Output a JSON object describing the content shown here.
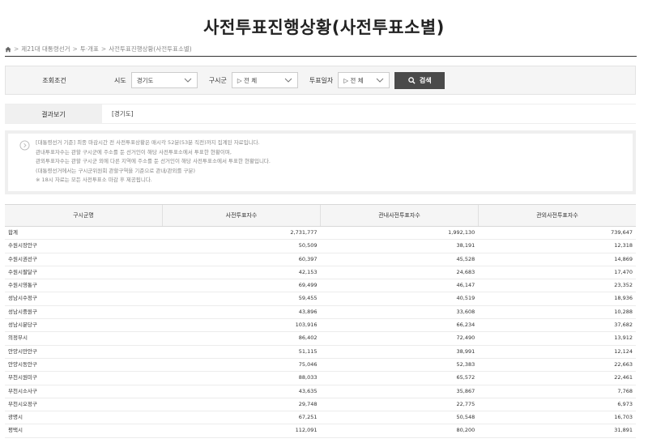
{
  "title": "사전투표진행상황(사전투표소별)",
  "breadcrumb": [
    "제21대 대통령선거",
    "투·개표",
    "사전투표진행상황(사전투표소별)"
  ],
  "search": {
    "label": "조회조건",
    "fields": [
      {
        "label": "시도",
        "value": "경기도"
      },
      {
        "label": "구시군",
        "value": "▷ 전 체"
      },
      {
        "label": "투표일자",
        "value": "▷ 전 체"
      }
    ],
    "button": "검색"
  },
  "result": {
    "label": "결과보기",
    "value": "[경기도]"
  },
  "notice": [
    "[대통령선거 기준] 최종 마감시간 전 사전투표상황은 매시각 52분(53분 직전)까지 집계된 자료입니다.",
    "관내투표자수는 관할 구시군에 주소를 둔 선거인이 해당 사전투표소에서 투표한 현황이며,",
    "관외투표자수는 관할 구시군 외에 다른 지역에 주소를 둔 선거인이 해당 사전투표소에서 투표한 현황입니다.",
    "(대통령선거에서는 구시군위원회 관할구역을 기준으로 관내/관외를 구분)",
    "※ 18시 자료는 모든 사전투표소 마감 후 제공됩니다."
  ],
  "table": {
    "headers": [
      "구시군명",
      "사전투표자수",
      "관내사전투표자수",
      "관외사전투표자수"
    ],
    "rows": [
      [
        "합계",
        "2,731,777",
        "1,992,130",
        "739,647"
      ],
      [
        "수원시장안구",
        "50,509",
        "38,191",
        "12,318"
      ],
      [
        "수원시권선구",
        "60,397",
        "45,528",
        "14,869"
      ],
      [
        "수원시팔달구",
        "42,153",
        "24,683",
        "17,470"
      ],
      [
        "수원시영통구",
        "69,499",
        "46,147",
        "23,352"
      ],
      [
        "성남시수정구",
        "59,455",
        "40,519",
        "18,936"
      ],
      [
        "성남시중원구",
        "43,896",
        "33,608",
        "10,288"
      ],
      [
        "성남시분당구",
        "103,916",
        "66,234",
        "37,682"
      ],
      [
        "의정부시",
        "86,402",
        "72,490",
        "13,912"
      ],
      [
        "안양시만안구",
        "51,115",
        "38,991",
        "12,124"
      ],
      [
        "안양시동안구",
        "75,046",
        "52,383",
        "22,663"
      ],
      [
        "부천시원미구",
        "88,033",
        "65,572",
        "22,461"
      ],
      [
        "부천시소사구",
        "43,635",
        "35,867",
        "7,768"
      ],
      [
        "부천시오정구",
        "29,748",
        "22,775",
        "6,973"
      ],
      [
        "광명시",
        "67,251",
        "50,548",
        "16,703"
      ],
      [
        "평택시",
        "112,091",
        "80,200",
        "31,891"
      ]
    ]
  }
}
